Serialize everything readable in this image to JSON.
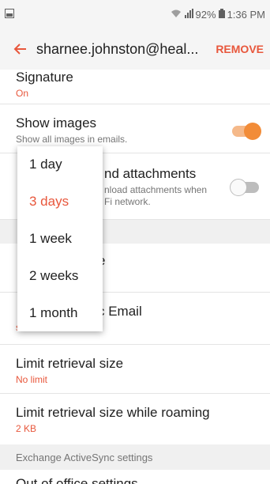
{
  "status_bar": {
    "battery": "92%",
    "time": "1:36 PM"
  },
  "app_bar": {
    "title": "sharnee.johnston@heal...",
    "action": "REMOVE"
  },
  "settings": {
    "signature": {
      "title": "Signature",
      "value": "On"
    },
    "show_images": {
      "title": "Show images",
      "description": "Show all images in emails.",
      "enabled": true
    },
    "auto_download": {
      "title_visible": "nd attachments",
      "desc_line1": "nload attachments when",
      "desc_line2": "Fi network.",
      "enabled": false
    },
    "partial_item_1": {
      "title_visible": "e"
    },
    "partial_item_2": {
      "title_visible": "c Email",
      "value_partial": "s"
    },
    "limit_retrieval": {
      "title": "Limit retrieval size",
      "value": "No limit"
    },
    "limit_roaming": {
      "title": "Limit retrieval size while roaming",
      "value": "2 KB"
    },
    "exchange_header": "Exchange ActiveSync settings",
    "out_of_office": {
      "title": "Out of office settings"
    }
  },
  "popup": {
    "options": [
      "1 day",
      "3 days",
      "1 week",
      "2 weeks",
      "1 month"
    ],
    "selected_index": 1
  },
  "colors": {
    "accent": "#e8573c",
    "toggle_on": "#f28c38"
  }
}
